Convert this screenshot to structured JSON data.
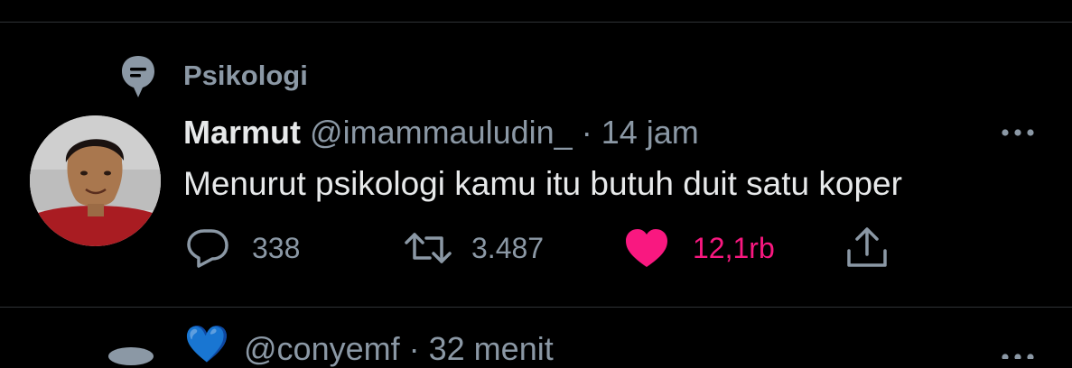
{
  "topic": {
    "icon": "topic-icon",
    "label": "Psikologi"
  },
  "tweet": {
    "author_name": "Marmut",
    "handle": "@imammauludin_",
    "separator": "·",
    "time": "14 jam",
    "text": "Menurut psikologi kamu itu butuh duit satu koper",
    "actions": {
      "reply_count": "338",
      "retweet_count": "3.487",
      "like_count": "12,1rb",
      "liked": true
    }
  },
  "next_tweet": {
    "handle": "@conyemf",
    "separator": "·",
    "time": "32 menit",
    "emoji": "💙"
  },
  "colors": {
    "background": "#000000",
    "text": "#e7e9ea",
    "muted": "#8b98a5",
    "like": "#f91880",
    "divider": "#2f3336"
  }
}
